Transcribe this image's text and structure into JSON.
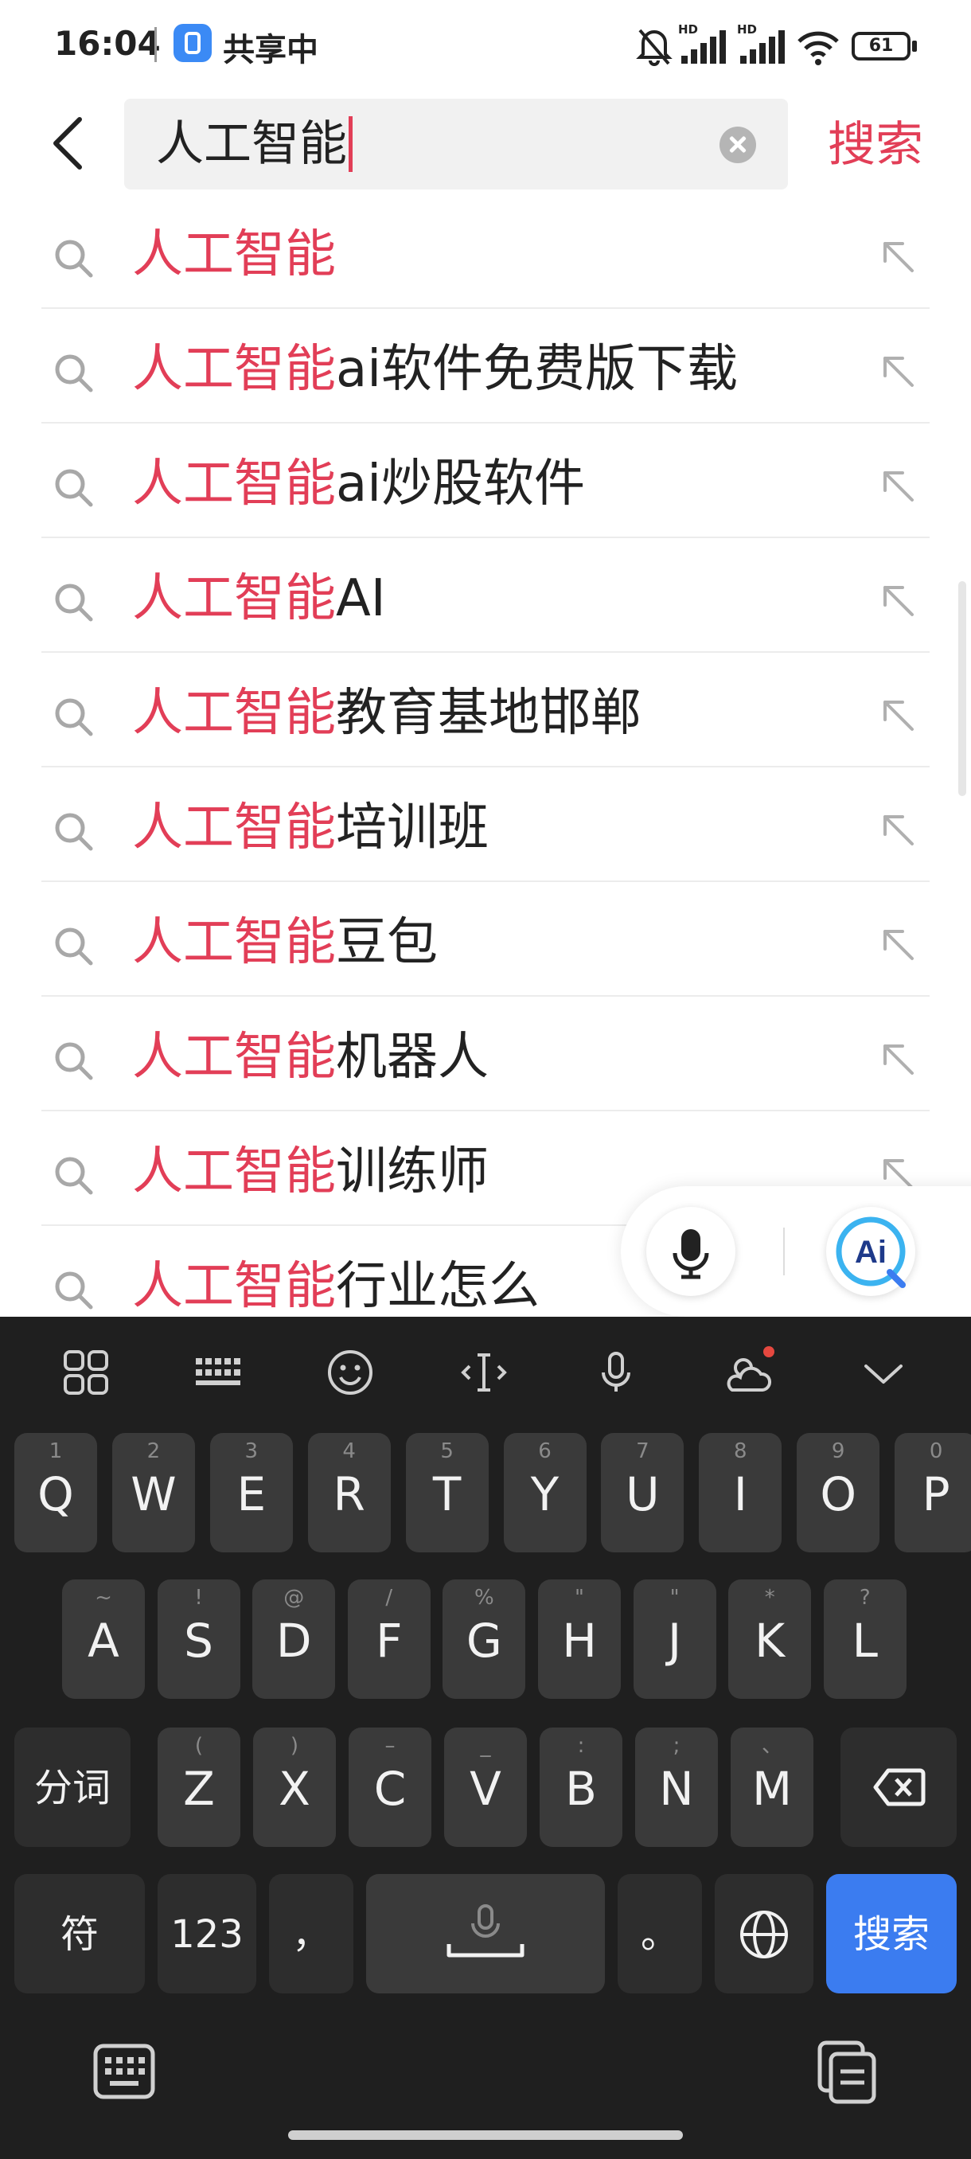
{
  "status_bar": {
    "time": "16:04",
    "share_label": "共享中",
    "network1": "HD",
    "network2": "HD",
    "battery": "61"
  },
  "search": {
    "value": "人工智能",
    "action_label": "搜索"
  },
  "suggestions": [
    {
      "highlight": "人工智能",
      "rest": ""
    },
    {
      "highlight": "人工智能",
      "rest": "ai软件免费版下载"
    },
    {
      "highlight": "人工智能",
      "rest": "ai炒股软件"
    },
    {
      "highlight": "人工智能",
      "rest": "AI"
    },
    {
      "highlight": "人工智能",
      "rest": "教育基地邯郸"
    },
    {
      "highlight": "人工智能",
      "rest": "培训班"
    },
    {
      "highlight": "人工智能",
      "rest": "豆包"
    },
    {
      "highlight": "人工智能",
      "rest": "机器人"
    },
    {
      "highlight": "人工智能",
      "rest": "训练师"
    },
    {
      "highlight": "人工智能",
      "rest": "行业怎么"
    }
  ],
  "float": {
    "ai_label": "Ai"
  },
  "keyboard": {
    "row1": [
      {
        "main": "Q",
        "sub": "1"
      },
      {
        "main": "W",
        "sub": "2"
      },
      {
        "main": "E",
        "sub": "3"
      },
      {
        "main": "R",
        "sub": "4"
      },
      {
        "main": "T",
        "sub": "5"
      },
      {
        "main": "Y",
        "sub": "6"
      },
      {
        "main": "U",
        "sub": "7"
      },
      {
        "main": "I",
        "sub": "8"
      },
      {
        "main": "O",
        "sub": "9"
      },
      {
        "main": "P",
        "sub": "0"
      }
    ],
    "row2": [
      {
        "main": "A",
        "sub": "~"
      },
      {
        "main": "S",
        "sub": "!"
      },
      {
        "main": "D",
        "sub": "@"
      },
      {
        "main": "F",
        "sub": "/"
      },
      {
        "main": "G",
        "sub": "%"
      },
      {
        "main": "H",
        "sub": "\""
      },
      {
        "main": "J",
        "sub": "\""
      },
      {
        "main": "K",
        "sub": "*"
      },
      {
        "main": "L",
        "sub": "?"
      }
    ],
    "row3": [
      {
        "main": "Z",
        "sub": "("
      },
      {
        "main": "X",
        "sub": ")"
      },
      {
        "main": "C",
        "sub": "–"
      },
      {
        "main": "V",
        "sub": "_"
      },
      {
        "main": "B",
        "sub": ":"
      },
      {
        "main": "N",
        "sub": ";"
      },
      {
        "main": "M",
        "sub": "、"
      }
    ],
    "split_label": "分词",
    "symbol_label": "符",
    "num_label": "123",
    "comma_label": "，",
    "period_label": "。",
    "enter_label": "搜索"
  },
  "colors": {
    "accent": "#e23e57",
    "keyboard_bg": "#1f1f1f",
    "key_bg": "#3a3a3a",
    "enter_bg": "#3b7cf0"
  }
}
